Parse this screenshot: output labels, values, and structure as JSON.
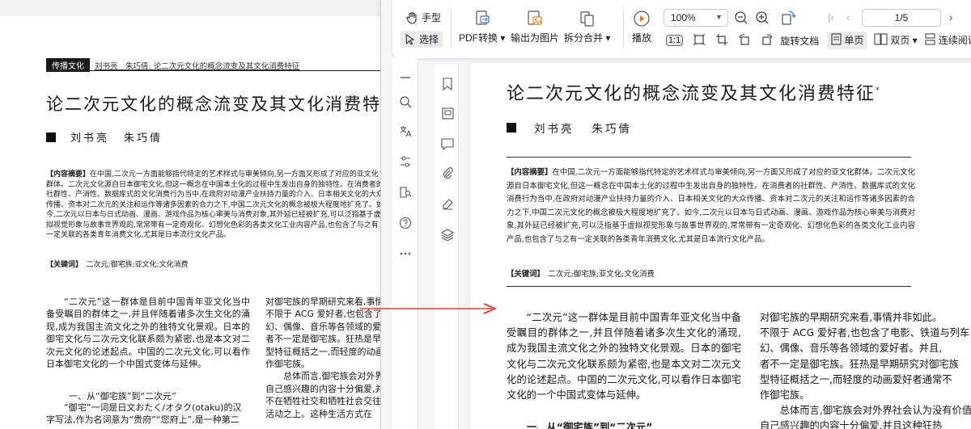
{
  "original": {
    "column_tag": "传播文化",
    "header_info": "刘书亮　朱巧倩: 论二次元文化的概念流变及其文化消费特征",
    "title": "论二次元文化的概念流变及其文化消费特征",
    "authors": [
      "刘书亮",
      "朱巧倩"
    ],
    "abstract_label": "【内容摘要】",
    "abstract_text": "在中国,二次元一方面能够指代特定的艺术样式与审美倾向,另一方面又形成了对应的亚文化群体。二次元文化源自日本御宅文化,但这一概念在中国本土化的过程中生发出自身的独特性。在消费者的社群性、产消性、数据库式的文化消费行为当中,在政府对动漫产业扶持力量的介入、日本相关文化的大众传播、资本对二次元的关注和运作等诸多因素的合力之下,中国二次元文化的概念被极大程度地扩充了。如今,二次元以日本与日式动画、漫画、游戏作品为核心审美与消费对象,其外延已经被扩充,可以泛指基于虚拟视觉形象与故事世界观的,常常带有一定奇观化、幻想化色彩的各类文化工业内容产品,也包含了与之有一定关联的各类青年消费文化,尤其是日本流行文化产品。",
    "keywords_label": "【关键词】",
    "keywords_text": "二次元;御宅族;亚文化;文化消费",
    "col1_text": "“二次元”这一群体是目前中国青年亚文化当中备受瞩目的群体之一,并且伴随着诸多次生文化的涌现,成为我国主流文化之外的独特文化景观。日本的御宅文化与二次元文化联系颇为紧密,也是本文对二次元文化的论述起点。中国的二次元文化,可以看作日本御宅文化的一个中国式变体与延伸。",
    "section1": "一、从“御宅族”到“二次元”",
    "col1b_text": "“御宅”一词是日文おたく/オタク(otaku)的汉字写法,作为名词意为“贵府”“您府上”,是一种第二",
    "col2_lines": [
      "对御宅族的早期研究来看,事情并非如此。",
      "不限于 ACG 爱好者,也包含了电影、铁道",
      "幻、偶像、音乐等各领域的爱好者。并且,",
      "者不一定是御宅族。狂热是早期研究对御宅",
      "型特征概括之一,而轻度的动画爱好者通常",
      "作御宅族。",
      "　　总体而言,御宅族会对外界社会认为没有",
      "自己感兴趣的内容十分偏爱,并且这种狂热",
      "不在牺牲社交和牺牲社会交往的前提下进行",
      "活动之上。这种生活方式在"
    ]
  },
  "viewer": {
    "tools": {
      "hand": "手型",
      "select": "选择",
      "pdf_convert": "PDF转换",
      "export_image": "输出为图片",
      "split_merge": "拆分合并",
      "play": "播放",
      "zoom_value": "100%",
      "rotate": "旋转文档",
      "single_page": "单页",
      "double_page": "双页",
      "continuous": "连续阅读",
      "page_indicator": "1/5"
    },
    "page": {
      "title": "论二次元文化的概念流变及其文化消费特征",
      "title_mark": "*",
      "authors": [
        "刘书亮",
        "朱巧倩"
      ],
      "abstract_label": "【内容摘要】",
      "abstract_text": "在中国,二次元一方面能够指代特定的艺术样式与审美倾向,另一方面又形成了对应的亚文化群体。二次元文化源自日本御宅文化,但这一概念在中国本土化的过程中生发出自身的独特性。在消费者的社群性、产消性、数据库式的文化消费行为当中,在政府对动漫产业扶持力量的介入、日本相关文化的大众传播、资本对二次元的关注和运作等诸多因素的合力之下,中国二次元文化的概念被极大程度地扩充了。如今,二次元以日本与日式动画、漫画、游戏作品为核心审美与消费对象,其外延已经被扩充,可以泛指基于虚拟视觉形象与故事世界观的,常常带有一定奇观化、幻想化色彩的各类文化工业内容产品,也包含了与之有一定关联的各类青年消费文化,尤其是日本流行文化产品。",
      "keywords_label": "【关键词】",
      "keywords_text": "二次元;御宅族;亚文化;文化消费",
      "col1_text": "“二次元”这一群体是目前中国青年亚文化当中备受瞩目的群体之一,并且伴随着诸多次生文化的涌现,成为我国主流文化之外的独特文化景观。日本的御宅文化与二次元文化联系颇为紧密,也是本文对二次元文化的论述起点。中国的二次元文化,可以看作日本御宅文化的一个中国式变体与延伸。",
      "section1": "一、从“御宅族”到“二次元”",
      "col2_lines": [
        "对御宅族的早期研究来看,事情并非如此。",
        "不限于 ACG 爱好者,也包含了电影、铁道与列车",
        "幻、偶像、音乐等各领域的爱好者。并且,",
        "者不一定是御宅族。狂热是早期研究对御宅族",
        "型特征概括之一,而轻度的动画爱好者通常不",
        "作御宅族。",
        "　　总体而言,御宅族会对外界社会认为没有价值",
        "自己感兴趣的内容十分偏爱,并且这种狂热"
      ]
    }
  },
  "colors": {
    "arrow": "#e53935",
    "accent": "#3a6fd8"
  }
}
